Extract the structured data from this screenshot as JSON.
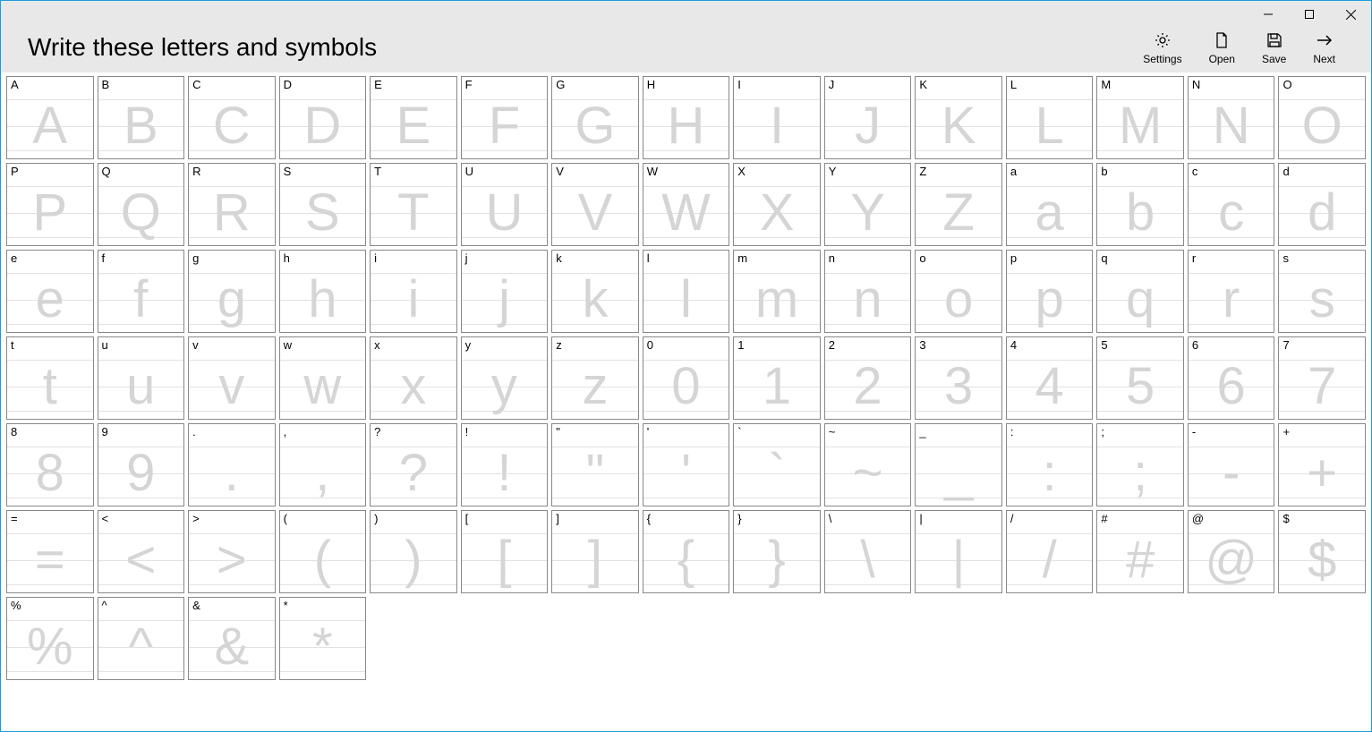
{
  "window": {
    "title": "Write these letters and symbols"
  },
  "toolbar": {
    "settings": "Settings",
    "open": "Open",
    "save": "Save",
    "next": "Next"
  },
  "cells": [
    "A",
    "B",
    "C",
    "D",
    "E",
    "F",
    "G",
    "H",
    "I",
    "J",
    "K",
    "L",
    "M",
    "N",
    "O",
    "P",
    "Q",
    "R",
    "S",
    "T",
    "U",
    "V",
    "W",
    "X",
    "Y",
    "Z",
    "a",
    "b",
    "c",
    "d",
    "e",
    "f",
    "g",
    "h",
    "i",
    "j",
    "k",
    "l",
    "m",
    "n",
    "o",
    "p",
    "q",
    "r",
    "s",
    "t",
    "u",
    "v",
    "w",
    "x",
    "y",
    "z",
    "0",
    "1",
    "2",
    "3",
    "4",
    "5",
    "6",
    "7",
    "8",
    "9",
    ".",
    ",",
    "?",
    "!",
    "\"",
    "'",
    "`",
    "~",
    "_",
    ":",
    ";",
    "-",
    "+",
    "=",
    "<",
    ">",
    "(",
    ")",
    "[",
    "]",
    "{",
    "}",
    "\\",
    "|",
    "/",
    "#",
    "@",
    "$",
    "%",
    "^",
    "&",
    "*"
  ]
}
